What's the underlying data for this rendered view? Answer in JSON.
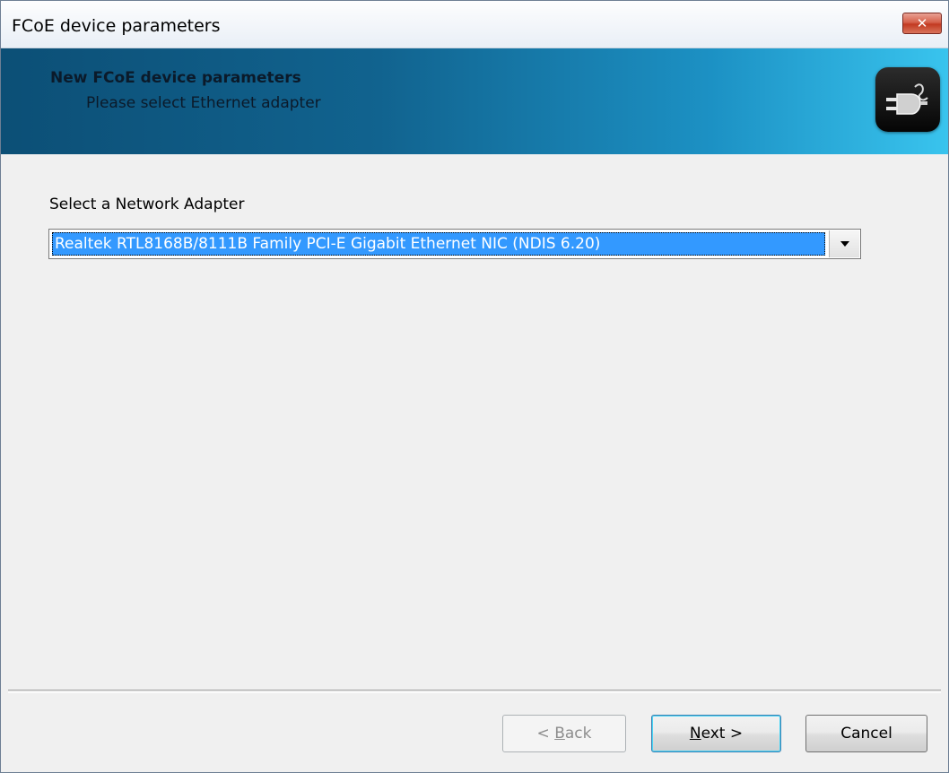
{
  "window": {
    "title": "FCoE device parameters",
    "close_label": "✕"
  },
  "header": {
    "title": "New FCoE device parameters",
    "subtitle": "Please select Ethernet adapter",
    "icon": "network-plug-icon"
  },
  "main": {
    "adapter_label": "Select a Network Adapter",
    "adapter_selected": "Realtek RTL8168B/8111B Family PCI-E Gigabit Ethernet NIC (NDIS 6.20)"
  },
  "buttons": {
    "back_prefix": "< ",
    "back_mnemonic": "B",
    "back_rest": "ack",
    "next_mnemonic": "N",
    "next_rest": "ext >",
    "cancel_label": "Cancel"
  },
  "colors": {
    "header_gradient_start": "#0c4f76",
    "header_gradient_end": "#39c4ee",
    "selection": "#3399ff",
    "close_button": "#c23a21"
  }
}
